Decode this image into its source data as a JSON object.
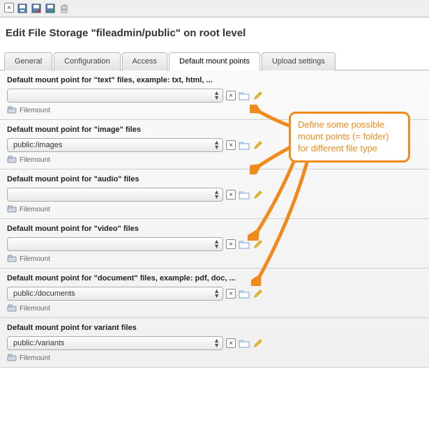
{
  "toolbar": {
    "close": "×",
    "save": "💾",
    "save_close": "💾",
    "save_new": "💾",
    "delete": "🗑"
  },
  "title": "Edit File Storage \"fileadmin/public\" on root level",
  "tabs": {
    "general": "General",
    "config": "Configuration",
    "access": "Access",
    "mount": "Default mount points",
    "upload": "Upload settings"
  },
  "sections": [
    {
      "label": "Default mount point for \"text\" files, example: txt, html, ...",
      "value": ""
    },
    {
      "label": "Default mount point for \"image\" files",
      "value": "public:/images"
    },
    {
      "label": "Default mount point for \"audio\" files",
      "value": ""
    },
    {
      "label": "Default mount point for \"video\" files",
      "value": ""
    },
    {
      "label": "Default mount point for \"document\" files, example: pdf, doc, ...",
      "value": "public:/documents"
    },
    {
      "label": "Default mount point for variant files",
      "value": "public:/variants"
    }
  ],
  "filemount_label": "Filemount",
  "callout_l1": "Define some possible",
  "callout_l2": "mount points (= folder)",
  "callout_l3": "for different file type"
}
